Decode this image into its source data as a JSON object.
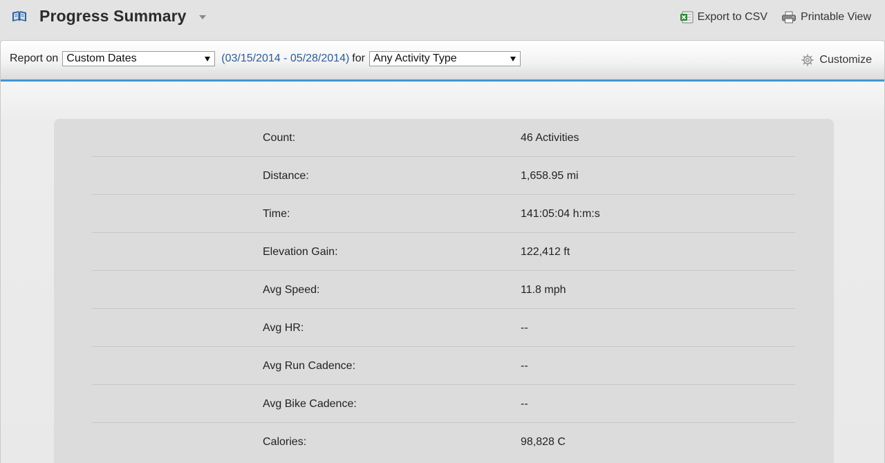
{
  "header": {
    "title": "Progress Summary",
    "export_label": "Export to CSV",
    "print_label": "Printable View"
  },
  "toolbar": {
    "report_on_label": "Report on",
    "period_selected": "Custom Dates",
    "date_range": "(03/15/2014 - 05/28/2014)",
    "for_label": "for",
    "activity_selected": "Any Activity Type",
    "customize_label": "Customize"
  },
  "stats": [
    {
      "label": "Count:",
      "value": "46 Activities"
    },
    {
      "label": "Distance:",
      "value": "1,658.95 mi"
    },
    {
      "label": "Time:",
      "value": "141:05:04 h:m:s"
    },
    {
      "label": "Elevation Gain:",
      "value": "122,412 ft"
    },
    {
      "label": "Avg Speed:",
      "value": "11.8 mph"
    },
    {
      "label": "Avg HR:",
      "value": "--"
    },
    {
      "label": "Avg Run Cadence:",
      "value": "--"
    },
    {
      "label": "Avg Bike Cadence:",
      "value": "--"
    },
    {
      "label": "Calories:",
      "value": "98,828 C"
    }
  ],
  "colors": {
    "accent": "#3d98d4",
    "link": "#2c5c97",
    "icon_blue": "#2f5f9e",
    "excel_green": "#2e8b3a"
  },
  "icons": {
    "title": "book-icon",
    "title_menu": "chevron-down-icon",
    "export": "excel-icon",
    "print": "printer-icon",
    "customize": "gear-icon"
  }
}
